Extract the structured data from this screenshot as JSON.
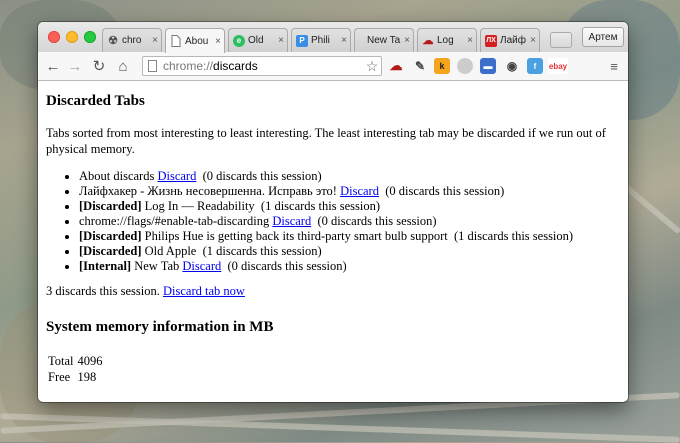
{
  "tabs": [
    {
      "title": "chro",
      "favicon": "radiation-icon",
      "color": "#777777"
    },
    {
      "title": "Abou",
      "favicon": "page-icon",
      "color": "#888888"
    },
    {
      "title": "Old",
      "favicon": "evernote-icon",
      "color": "#2dbe60"
    },
    {
      "title": "Phili",
      "favicon": "hue-icon",
      "color": "#3a8ee6"
    },
    {
      "title": "New Ta",
      "favicon": "",
      "color": ""
    },
    {
      "title": "Log",
      "favicon": "readability-icon",
      "color": "#b51a1a"
    },
    {
      "title": "Лайф",
      "favicon": "lh-icon",
      "color": "#d42020"
    }
  ],
  "tab_close": "×",
  "profile_label": "Артем",
  "omnibox": {
    "scheme": "chrome://",
    "host": "discards"
  },
  "page": {
    "title": "Discarded Tabs",
    "description": "Tabs sorted from most interesting to least interesting. The least interesting tab may be discarded if we run out of physical memory.",
    "discard_link": "Discard",
    "items": [
      {
        "prefix": "",
        "title": "About discards",
        "has_link": true,
        "count": "(0 discards this session)"
      },
      {
        "prefix": "",
        "title": "Лайфхакер - Жизнь несовершенна. Исправь это!",
        "has_link": true,
        "count": "(0 discards this session)"
      },
      {
        "prefix": "[Discarded]",
        "title": "Log In — Readability",
        "has_link": false,
        "count": "(1 discards this session)"
      },
      {
        "prefix": "",
        "title": "chrome://flags/#enable-tab-discarding",
        "has_link": true,
        "count": "(0 discards this session)"
      },
      {
        "prefix": "[Discarded]",
        "title": "Philips Hue is getting back its third-party smart bulb support",
        "has_link": false,
        "count": "(1 discards this session)"
      },
      {
        "prefix": "[Discarded]",
        "title": "Old Apple",
        "has_link": false,
        "count": "(1 discards this session)"
      },
      {
        "prefix": "[Internal]",
        "title": "New Tab",
        "has_link": true,
        "count": "(0 discards this session)"
      }
    ],
    "summary_text": "3 discards this session.",
    "discard_now_link": "Discard tab now",
    "memory_heading": "System memory information in MB",
    "memory": [
      {
        "label": "Total",
        "value": "4096"
      },
      {
        "label": "Free",
        "value": "198"
      }
    ]
  }
}
